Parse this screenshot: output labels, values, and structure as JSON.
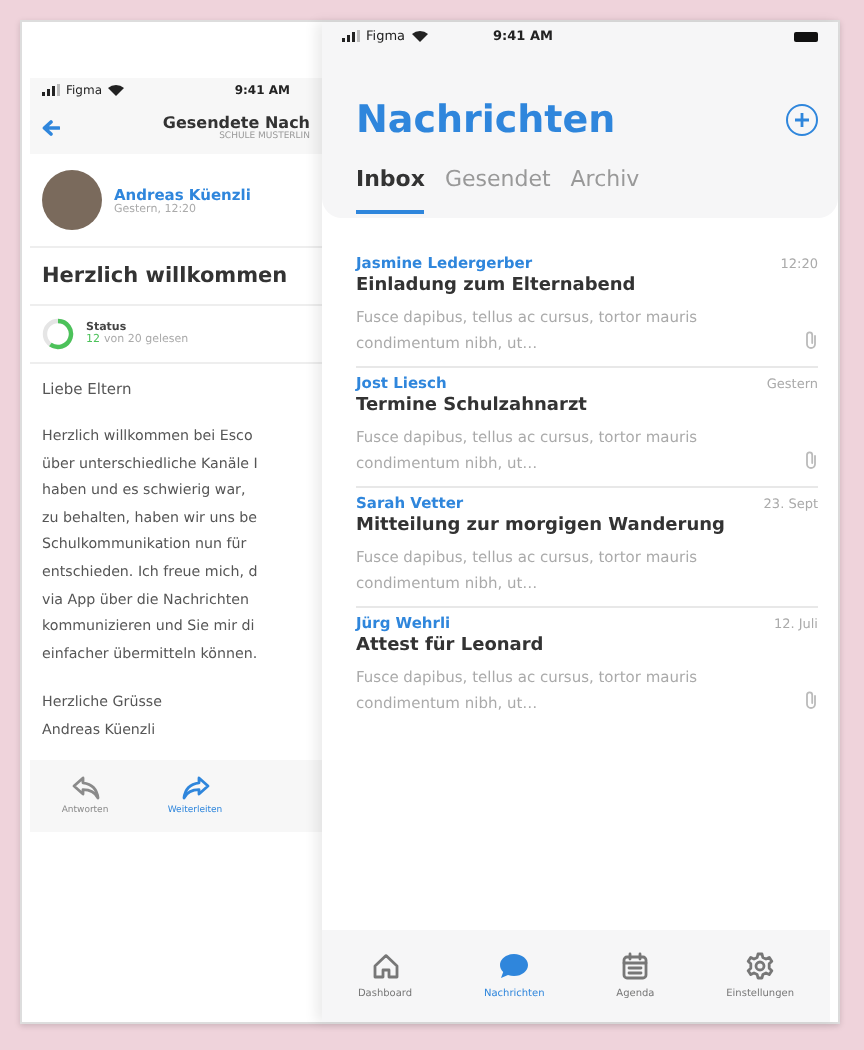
{
  "left_screen": {
    "status_bar": {
      "carrier": "Figma",
      "time": "9:41 AM"
    },
    "header": {
      "title": "Gesendete Nach",
      "subtitle": "SCHULE MUSTERLIN"
    },
    "author": {
      "name": "Andreas Küenzli",
      "date": "Gestern, 12:20"
    },
    "subject": "Herzlich willkommen",
    "status": {
      "label": "Status",
      "count": "12",
      "rest": "von 20 gelesen",
      "level": 0.6
    },
    "greeting": "Liebe Eltern",
    "body_lines": [
      "Herzlich willkommen bei Esco",
      "über unterschiedliche Kanäle I",
      "haben und es schwierig war,",
      "zu behalten, haben wir uns be",
      "Schulkommunikation nun für",
      "entschieden. Ich freue mich, d",
      "via App über die Nachrichten",
      "kommunizieren und Sie mir di",
      "einfacher übermitteln können."
    ],
    "closing_lines": [
      "Herzliche Grüsse",
      "Andreas Küenzli"
    ],
    "actions": [
      {
        "kind": "reply",
        "label": "Antworten",
        "selected": false
      },
      {
        "kind": "forward",
        "label": "Weiterleiten",
        "selected": true
      }
    ]
  },
  "right_screen": {
    "status_bar": {
      "carrier": "Figma",
      "time": "9:41 AM"
    },
    "title": "Nachrichten",
    "tabs": [
      {
        "label": "Inbox",
        "selected": true
      },
      {
        "label": "Gesendet",
        "selected": false
      },
      {
        "label": "Archiv",
        "selected": false
      }
    ],
    "messages": [
      {
        "sender": "Jasmine Ledergerber",
        "time": "12:20",
        "subject": "Einladung zum Elternabend",
        "preview": "Fusce dapibus, tellus ac cursus, tortor mauris condimentum nibh, ut…",
        "attachment": true
      },
      {
        "sender": "Jost Liesch",
        "time": "Gestern",
        "subject": "Termine Schulzahnarzt",
        "preview": "Fusce dapibus, tellus ac cursus, tortor mauris condimentum nibh, ut…",
        "attachment": true
      },
      {
        "sender": "Sarah Vetter",
        "time": "23. Sept",
        "subject": "Mitteilung zur morgigen Wanderung",
        "preview": "Fusce dapibus, tellus ac cursus, tortor mauris condimentum nibh, ut…",
        "attachment": false
      },
      {
        "sender": "Jürg Wehrli",
        "time": "12. Juli",
        "subject": "Attest für Leonard",
        "preview": "Fusce dapibus, tellus ac cursus, tortor mauris condimentum nibh, ut…",
        "attachment": true
      }
    ],
    "nav": [
      {
        "kind": "home",
        "label": "Dashboard",
        "selected": false
      },
      {
        "kind": "chat",
        "label": "Nachrichten",
        "selected": true
      },
      {
        "kind": "calendar",
        "label": "Agenda",
        "selected": false
      },
      {
        "kind": "gear",
        "label": "Einstellungen",
        "selected": false
      }
    ]
  }
}
